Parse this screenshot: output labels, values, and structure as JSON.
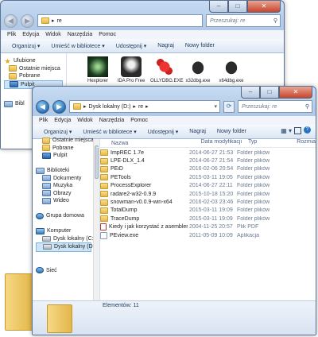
{
  "back_window": {
    "address": "re",
    "search_placeholder": "Przeszukaj: re",
    "menu": [
      "Plik",
      "Edycja",
      "Widok",
      "Narzędzia",
      "Pomoc"
    ],
    "toolbar": [
      "Organizuj ▾",
      "Umieść w bibliotece ▾",
      "Udostępnij ▾",
      "Nagraj",
      "Nowy folder"
    ],
    "nav": [
      "Ulubione",
      "Ostatnie miejsca",
      "Pobrane",
      "Pulpit",
      "Bibl"
    ],
    "icons": [
      "Hexplorer",
      "IDA Pro Free",
      "OLLYDBG.EXE",
      "x32dbg.exe",
      "x64dbg.exe"
    ]
  },
  "front_window": {
    "address_parts": [
      "Dysk lokalny (D:)",
      "re"
    ],
    "search_placeholder": "Przeszukaj: re",
    "menu": [
      "Plik",
      "Edycja",
      "Widok",
      "Narzędzia",
      "Pomoc"
    ],
    "toolbar": [
      "Organizuj ▾",
      "Umieść w bibliotece ▾",
      "Udostępnij ▾",
      "Nagraj",
      "Nowy folder"
    ],
    "columns": [
      "Nazwa",
      "Data modyfikacji",
      "Typ",
      "Rozmiar"
    ],
    "files": [
      {
        "name": "ImpREC 1.7e",
        "date": "2014-06-27 21:53",
        "type": "Folder plików",
        "icon": "folder-icon"
      },
      {
        "name": "LPE-DLX_1.4",
        "date": "2014-06-27 21:54",
        "type": "Folder plików",
        "icon": "folder-icon"
      },
      {
        "name": "PEiD",
        "date": "2016-02-06 20:54",
        "type": "Folder plików",
        "icon": "folder-icon"
      },
      {
        "name": "PETools",
        "date": "2015-03-11 19:05",
        "type": "Folder plików",
        "icon": "folder-icon"
      },
      {
        "name": "ProcessExplorer",
        "date": "2014-06-27 22:11",
        "type": "Folder plików",
        "icon": "folder-icon"
      },
      {
        "name": "radare2-w32-0.9.9",
        "date": "2015-10-18 15:20",
        "type": "Folder plików",
        "icon": "folder-icon"
      },
      {
        "name": "snowman-v0.0.9-win-x64",
        "date": "2016-02-03 23:46",
        "type": "Folder plików",
        "icon": "folder-icon"
      },
      {
        "name": "TotalDump",
        "date": "2015-03-11 19:09",
        "type": "Folder plików",
        "icon": "folder-icon"
      },
      {
        "name": "TraceDump",
        "date": "2015-03-11 19:09",
        "type": "Folder plików",
        "icon": "folder-icon"
      },
      {
        "name": "Kiedy i jak korzystać z asemblera.pdf",
        "date": "2004-11-25 20:57",
        "type": "Plik PDF",
        "icon": "pdf-icon"
      },
      {
        "name": "PEview.exe",
        "date": "2011-05-09 10:09",
        "type": "Aplikacja",
        "icon": "exe-icon"
      }
    ],
    "nav": [
      {
        "label": "Ostatnie miejsca",
        "icon": "folder-icon",
        "indent": 1
      },
      {
        "label": "Pobrane",
        "icon": "folder-icon",
        "indent": 1
      },
      {
        "label": "Pulpit",
        "icon": "desktop-icon",
        "indent": 1
      },
      {
        "label": "",
        "icon": "",
        "indent": 0
      },
      {
        "label": "Biblioteki",
        "icon": "library-icon",
        "indent": 0
      },
      {
        "label": "Dokumenty",
        "icon": "library-icon",
        "indent": 1
      },
      {
        "label": "Muzyka",
        "icon": "library-icon",
        "indent": 1
      },
      {
        "label": "Obrazy",
        "icon": "library-icon",
        "indent": 1
      },
      {
        "label": "Wideo",
        "icon": "library-icon",
        "indent": 1
      },
      {
        "label": "",
        "icon": "",
        "indent": 0
      },
      {
        "label": "Grupa domowa",
        "icon": "homegroup-icon",
        "indent": 0
      },
      {
        "label": "",
        "icon": "",
        "indent": 0
      },
      {
        "label": "Komputer",
        "icon": "computer-icon",
        "indent": 0
      },
      {
        "label": "Dysk lokalny (C:)",
        "icon": "drive-icon",
        "indent": 1
      },
      {
        "label": "Dysk lokalny (D:)",
        "icon": "drive-icon",
        "indent": 1,
        "selected": true
      },
      {
        "label": "",
        "icon": "",
        "indent": 0
      },
      {
        "label": "",
        "icon": "",
        "indent": 0
      },
      {
        "label": "Sieć",
        "icon": "network-icon",
        "indent": 0
      }
    ],
    "status": "Elementów: 11"
  }
}
